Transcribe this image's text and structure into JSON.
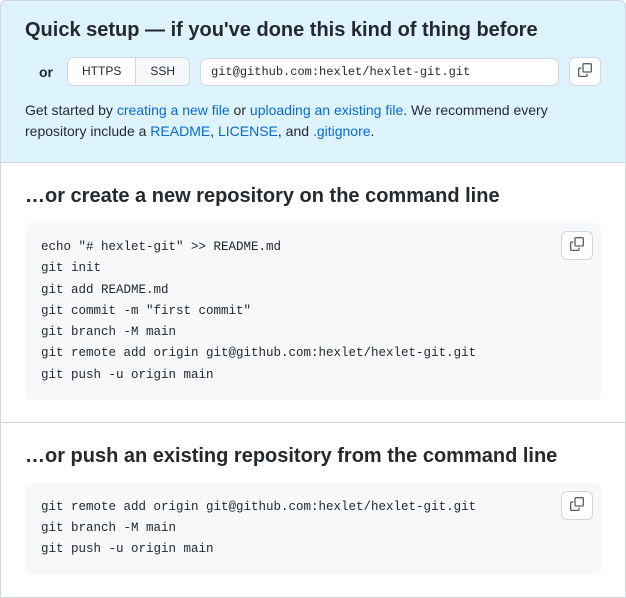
{
  "quick_setup": {
    "heading": "Quick setup — if you've done this kind of thing before",
    "or_label": "or",
    "https_button": "HTTPS",
    "ssh_button": "SSH",
    "repo_url": "git@github.com:hexlet/hexlet-git.git",
    "help_prefix": "Get started by ",
    "link_create": "creating a new file",
    "help_or": " or ",
    "link_upload": "uploading an existing file",
    "help_recommend": ". We recommend every repository include a ",
    "link_readme": "README",
    "sep1": ", ",
    "link_license": "LICENSE",
    "sep2": ", and ",
    "link_gitignore": ".gitignore",
    "help_end": "."
  },
  "create_repo": {
    "heading": "…or create a new repository on the command line",
    "code": "echo \"# hexlet-git\" >> README.md\ngit init\ngit add README.md\ngit commit -m \"first commit\"\ngit branch -M main\ngit remote add origin git@github.com:hexlet/hexlet-git.git\ngit push -u origin main"
  },
  "push_repo": {
    "heading": "…or push an existing repository from the command line",
    "code": "git remote add origin git@github.com:hexlet/hexlet-git.git\ngit branch -M main\ngit push -u origin main"
  }
}
